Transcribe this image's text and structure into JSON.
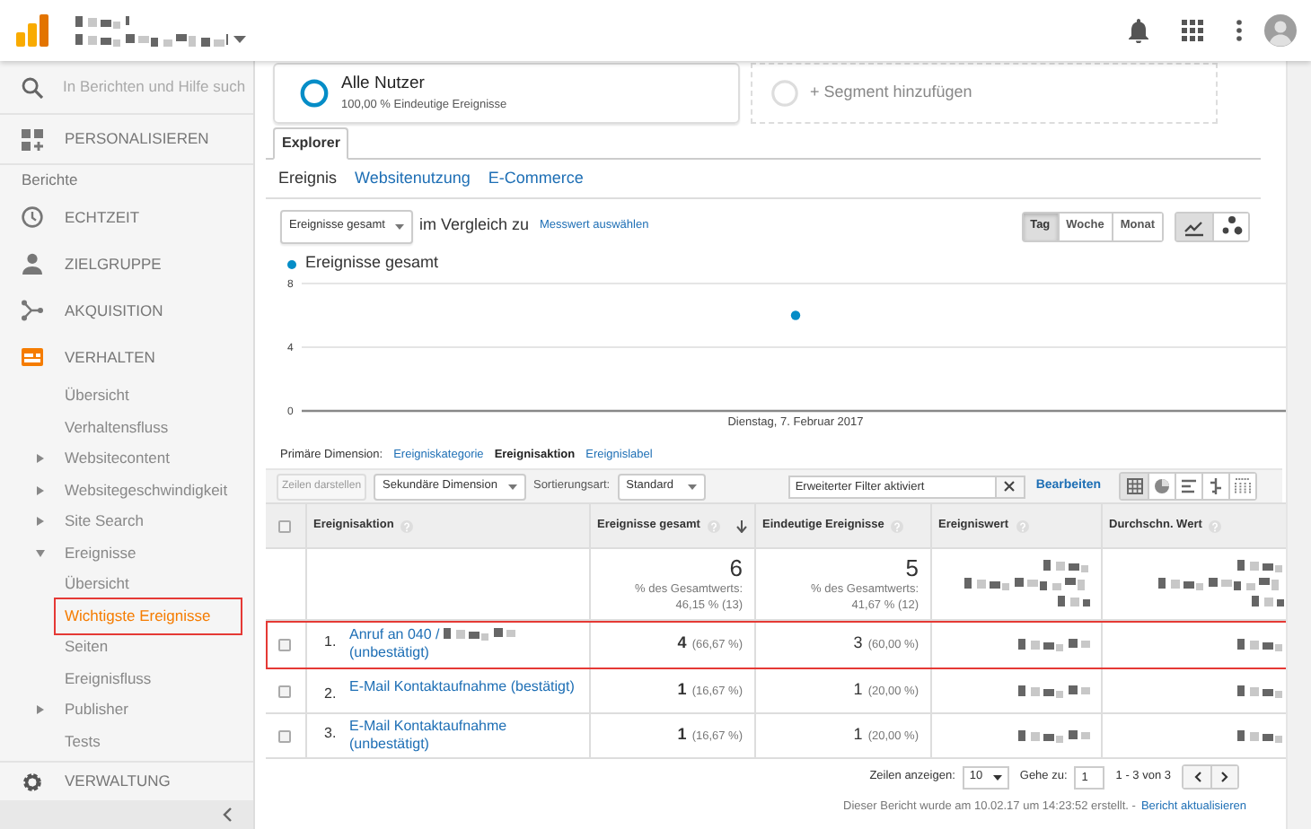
{
  "search": {
    "placeholder": "In Berichten und Hilfe such"
  },
  "sidebar": {
    "items": [
      {
        "kind": "section",
        "label": "PERSONALISIEREN",
        "selected": false
      },
      {
        "kind": "heading",
        "label": "Berichte"
      },
      {
        "kind": "section",
        "label": "ECHTZEIT",
        "selected": false
      },
      {
        "kind": "section",
        "label": "ZIELGRUPPE",
        "selected": false
      },
      {
        "kind": "section",
        "label": "AKQUISITION",
        "selected": false
      },
      {
        "kind": "section",
        "label": "VERHALTEN",
        "selected": true,
        "children": [
          {
            "label": "Übersicht",
            "selected": false
          },
          {
            "label": "Verhaltensfluss",
            "selected": false
          },
          {
            "label": "Websitecontent",
            "selected": false,
            "expanded": false
          },
          {
            "label": "Websitegeschwindigkeit",
            "selected": false,
            "expanded": false
          },
          {
            "label": "Site Search",
            "selected": false,
            "expanded": false
          },
          {
            "label": "Ereignisse",
            "selected": false,
            "expanded": true,
            "children": [
              {
                "label": "Übersicht",
                "selected": false
              },
              {
                "label": "Wichtigste Ereignisse",
                "selected": true,
                "highlighted": true
              },
              {
                "label": "Seiten",
                "selected": false
              },
              {
                "label": "Ereignisfluss",
                "selected": false
              }
            ]
          },
          {
            "label": "Publisher",
            "selected": false,
            "expanded": false
          },
          {
            "label": "Tests",
            "selected": false
          }
        ]
      }
    ],
    "footer": {
      "label": "VERWALTUNG"
    }
  },
  "segments": [
    {
      "kind": "active",
      "name": "Alle Nutzer",
      "detail": "100,00 % Eindeutige Ereignisse"
    },
    {
      "kind": "add",
      "name": "+ Segment hinzufügen"
    }
  ],
  "tabs": [
    {
      "label": "Explorer",
      "selected": true
    }
  ],
  "subtabs": [
    {
      "label": "Ereignis",
      "selected": true
    },
    {
      "label": "Websitenutzung",
      "selected": false
    },
    {
      "label": "E-Commerce",
      "selected": false
    }
  ],
  "metric": {
    "value": "Ereignisse gesamt",
    "compare_text": "im Vergleich zu",
    "compare_link": "Messwert auswählen"
  },
  "periods": [
    {
      "label": "Tag",
      "selected": true
    },
    {
      "label": "Woche",
      "selected": false
    },
    {
      "label": "Monat",
      "selected": false
    }
  ],
  "chart_types": [
    {
      "kind": "line",
      "selected": true
    },
    {
      "kind": "motion",
      "selected": false
    }
  ],
  "chart_data": {
    "type": "line",
    "categories": [
      "Dienstag, 7. Februar 2017"
    ],
    "series": [
      {
        "name": "Ereignisse gesamt",
        "color": "#058dc7",
        "marker": "circle",
        "values": [
          6
        ]
      }
    ],
    "ylim": [
      0,
      8
    ],
    "yticks": [
      0,
      4,
      8
    ]
  },
  "primary_dimension": {
    "label": "Primäre Dimension:",
    "options": [
      {
        "label": "Ereigniskategorie",
        "selected": false
      },
      {
        "label": "Ereignisaktion",
        "selected": true
      },
      {
        "label": "Ereignislabel",
        "selected": false
      }
    ]
  },
  "toolbar": {
    "plot_rows": {
      "label": "Zeilen darstellen",
      "disabled": true
    },
    "secondary_dimension": "Sekundäre Dimension",
    "sort_label": "Sortierungsart:",
    "sort_value": "Standard",
    "filter_value": "Erweiterter Filter aktiviert",
    "edit_link": "Bearbeiten",
    "views": [
      {
        "kind": "table",
        "selected": true
      },
      {
        "kind": "pie",
        "selected": false
      },
      {
        "kind": "performance",
        "selected": false
      },
      {
        "kind": "comparison",
        "selected": false
      },
      {
        "kind": "pivot",
        "selected": false
      }
    ]
  },
  "table": {
    "all_checked": false,
    "columns": [
      {
        "label": "Ereignisaktion",
        "sorted": false
      },
      {
        "label": "Ereignisse gesamt",
        "sorted": true
      },
      {
        "label": "Eindeutige Ereignisse",
        "sorted": false
      },
      {
        "label": "Ereigniswert",
        "sorted": false
      },
      {
        "label": "Durchschn. Wert",
        "sorted": false
      }
    ],
    "totals": [
      {
        "value": "6",
        "note": "% des Gesamtwerts: 46,15 % (13)"
      },
      {
        "value": "5",
        "note": "% des Gesamtwerts: 41,67 % (12)"
      }
    ],
    "rows": [
      {
        "index": "1.",
        "label": "Anruf an 040 /",
        "label_end": "(unbestätigt)",
        "checked": false,
        "highlighted": true,
        "events": "4",
        "events_pct": "(66,67 %)",
        "unique": "3",
        "unique_pct": "(60,00 %)"
      },
      {
        "index": "2.",
        "label": "E-Mail Kontaktaufnahme (bestätigt)",
        "checked": false,
        "highlighted": false,
        "events": "1",
        "events_pct": "(16,67 %)",
        "unique": "1",
        "unique_pct": "(20,00 %)"
      },
      {
        "index": "3.",
        "label": "E-Mail Kontaktaufnahme (unbestätigt)",
        "checked": false,
        "highlighted": false,
        "events": "1",
        "events_pct": "(16,67 %)",
        "unique": "1",
        "unique_pct": "(20,00 %)"
      }
    ]
  },
  "pagination": {
    "rows_label": "Zeilen anzeigen:",
    "rows_value": "10",
    "goto_label": "Gehe zu:",
    "goto_value": "1",
    "range": "1 - 3 von 3"
  },
  "footer": {
    "text": "Dieser Bericht wurde am 10.02.17 um 14:23:52 erstellt. -",
    "link": "Bericht aktualisieren"
  }
}
